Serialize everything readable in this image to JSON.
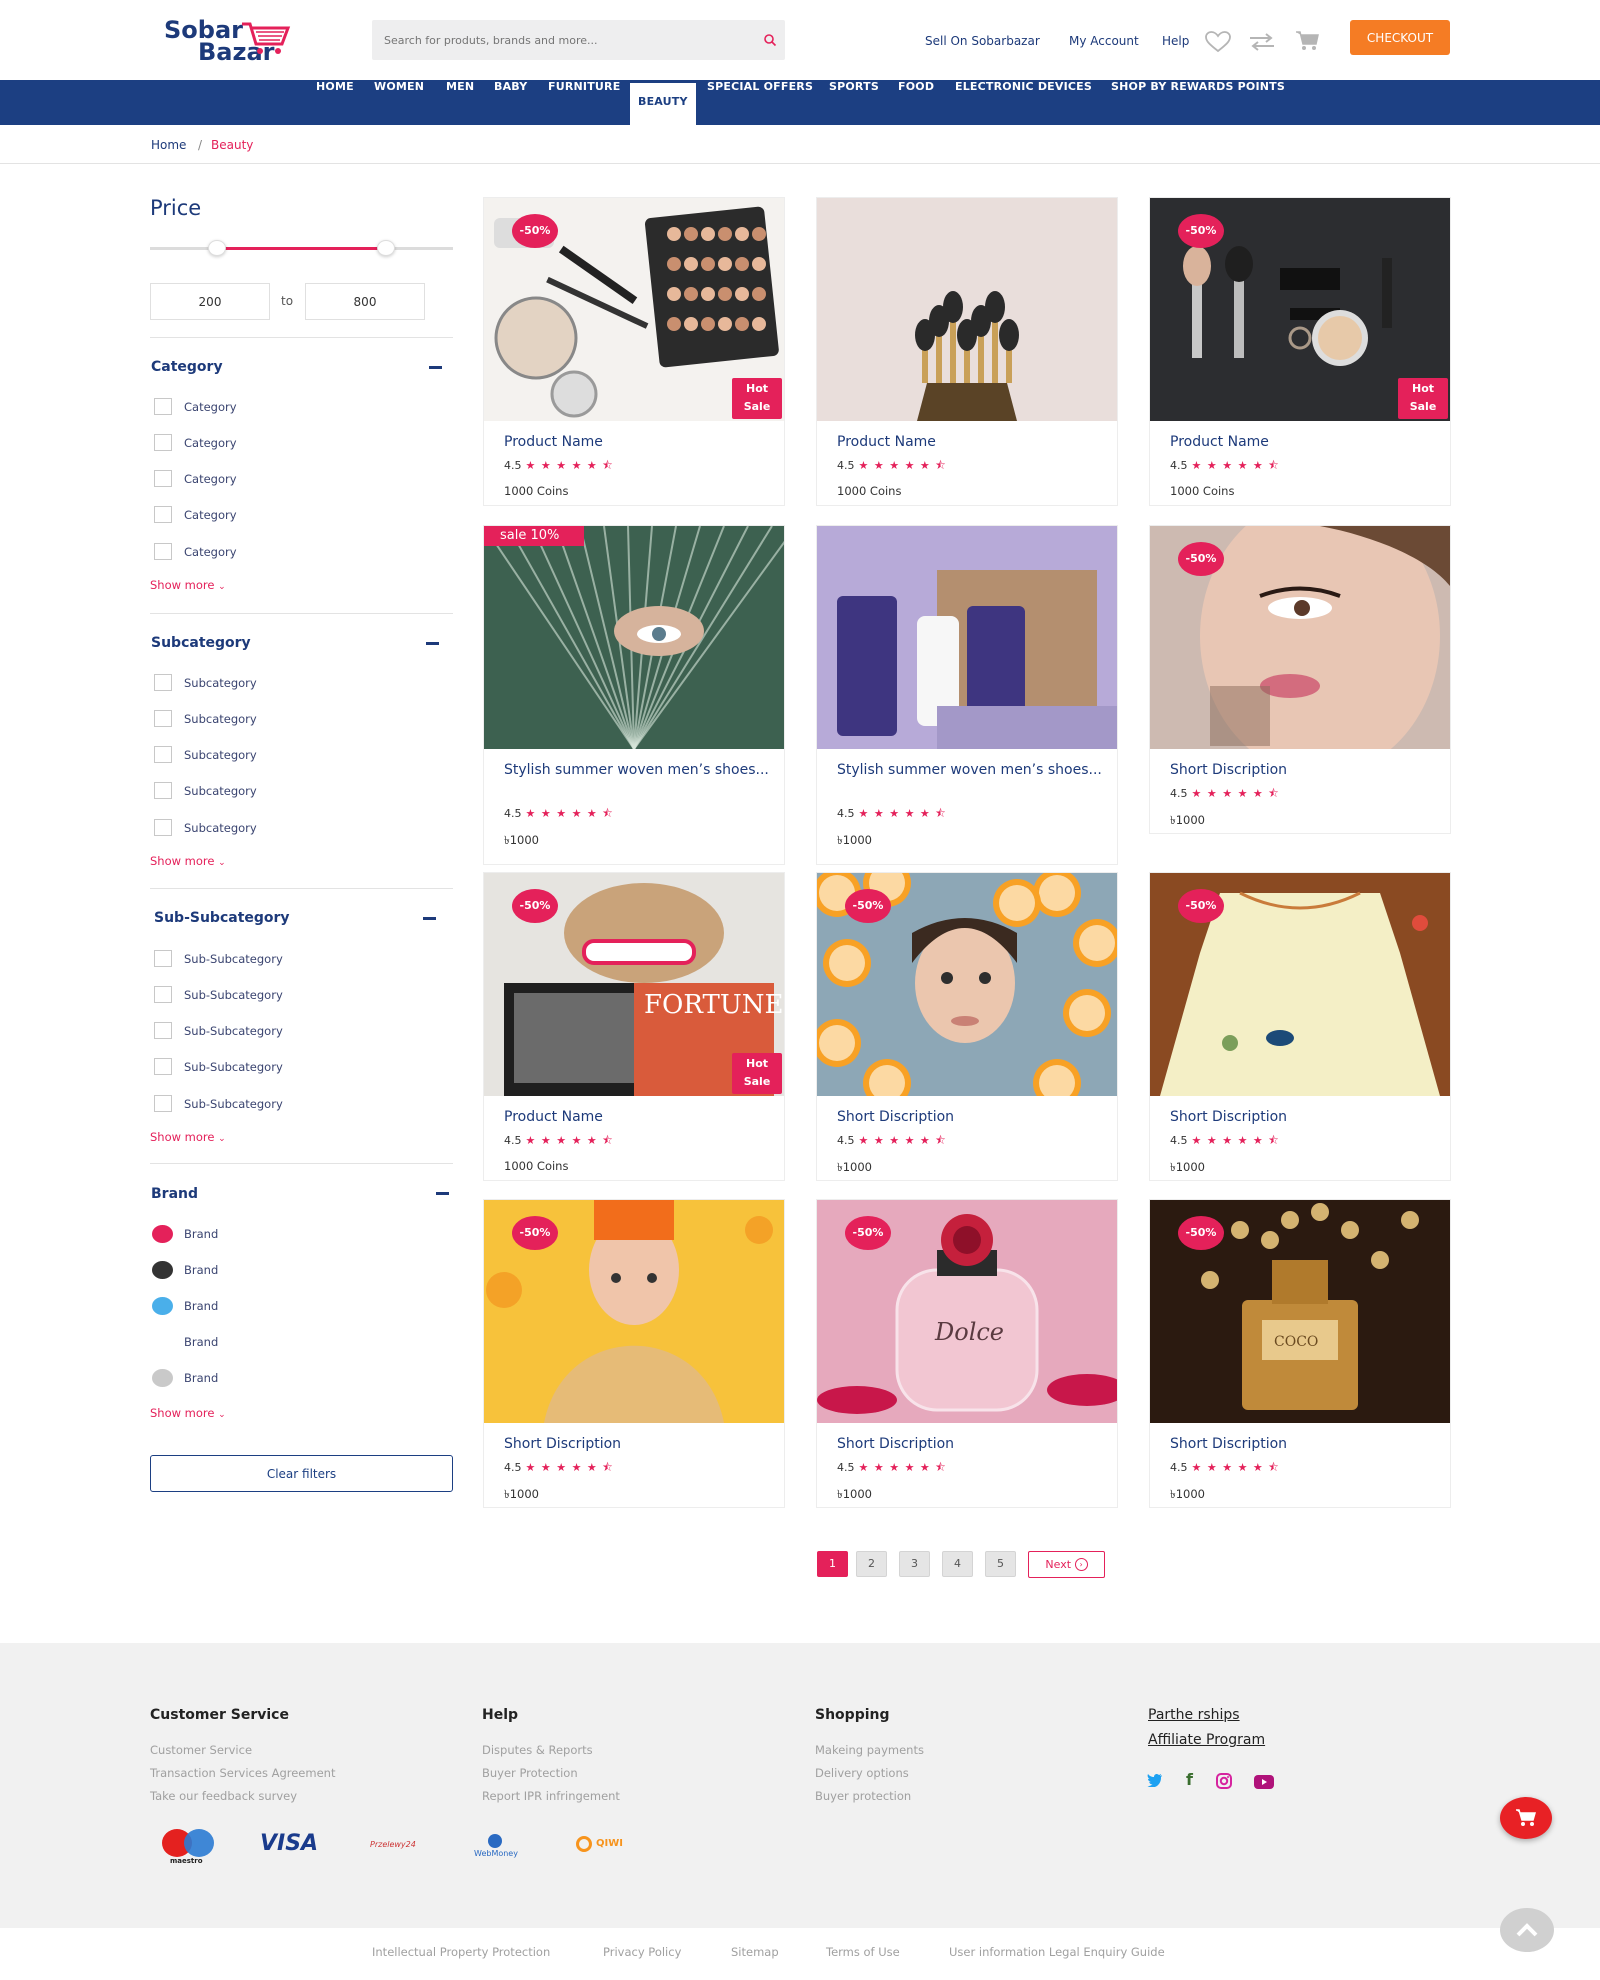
{
  "header": {
    "logo_line1": "Sobar",
    "logo_line2": "Bazar",
    "search_placeholder": "Search for produts, brands and more...",
    "links": [
      "Sell On Sobarbazar",
      "My Account",
      "Help"
    ],
    "checkout_label": "CHECKOUT"
  },
  "nav": {
    "items": [
      "HOME",
      "WOMEN",
      "MEN",
      "BABY",
      "FURNITURE",
      "BEAUTY",
      "SPECIAL OFFERS",
      "SPORTS",
      "FOOD",
      "ELECTRONIC DEVICES",
      "SHOP BY REWARDS POINTS"
    ],
    "active": "BEAUTY"
  },
  "breadcrumb": {
    "home": "Home",
    "separator": "/",
    "current": "Beauty"
  },
  "filters": {
    "price": {
      "title": "Price",
      "min": "200",
      "max": "800",
      "to_label": "to",
      "range_min": 0.22,
      "range_max": 0.78
    },
    "category": {
      "title": "Category",
      "items": [
        "Category",
        "Category",
        "Category",
        "Category",
        "Category"
      ]
    },
    "subcategory": {
      "title": "Subcategory",
      "items": [
        "Subcategory",
        "Subcategory",
        "Subcategory",
        "Subcategory",
        "Subcategory"
      ]
    },
    "subsubcategory": {
      "title": "Sub-Subcategory",
      "items": [
        "Sub-Subcategory",
        "Sub-Subcategory",
        "Sub-Subcategory",
        "Sub-Subcategory",
        "Sub-Subcategory"
      ]
    },
    "brand": {
      "title": "Brand",
      "items": [
        {
          "label": "Brand",
          "color": "#e4215a"
        },
        {
          "label": "Brand",
          "color": "#333333"
        },
        {
          "label": "Brand",
          "color": "#4aafea"
        },
        {
          "label": "Brand",
          "color": "#ffffff"
        },
        {
          "label": "Brand",
          "color": "#c9c9c9"
        }
      ]
    },
    "show_more": "Show more",
    "clear_filters": "Clear filters"
  },
  "products": [
    {
      "name": "Product Name",
      "rating": "4.5",
      "price": "1000 Coins",
      "badge": "-50%",
      "hot": true,
      "image": "makeup-palette"
    },
    {
      "name": "Product Name",
      "rating": "4.5",
      "price": "1000 Coins",
      "badge": "",
      "hot": false,
      "image": "makeup-brushes"
    },
    {
      "name": "Product Name",
      "rating": "4.5",
      "price": "1000 Coins",
      "badge": "-50%",
      "hot": true,
      "image": "cosmetics-dark"
    },
    {
      "name": "Stylish summer woven men’s shoes...",
      "rating": "4.5",
      "price": "৳1000",
      "sale": "sale 10%",
      "image": "leaf-face"
    },
    {
      "name": "Stylish summer woven men’s shoes...",
      "rating": "4.5",
      "price": "৳1000",
      "badge": "",
      "image": "skincare-tubes"
    },
    {
      "name": "Short Discription",
      "rating": "4.5",
      "price": "৳1000",
      "badge": "-50%",
      "image": "lipstick-woman"
    },
    {
      "name": "Product Name",
      "rating": "4.5",
      "price": "1000 Coins",
      "badge": "-50%",
      "hot": true,
      "image": "magazine-woman"
    },
    {
      "name": "Short Discription",
      "rating": "4.5",
      "price": "৳1000",
      "badge": "-50%",
      "image": "citrus-face"
    },
    {
      "name": "Short Discription",
      "rating": "4.5",
      "price": "৳1000",
      "badge": "-50%",
      "image": "yellow-dress"
    },
    {
      "name": "Short Discription",
      "rating": "4.5",
      "price": "৳1000",
      "badge": "-50%",
      "image": "yellow-hair"
    },
    {
      "name": "Short Discription",
      "rating": "4.5",
      "price": "৳1000",
      "badge": "-50%",
      "image": "pink-perfume"
    },
    {
      "name": "Short Discription",
      "rating": "4.5",
      "price": "৳1000",
      "badge": "-50%",
      "image": "coco-perfume"
    }
  ],
  "hot_label_1": "Hot",
  "hot_label_2": "Sale",
  "stars": "★ ★ ★ ★ ★ ⯪",
  "pagination": {
    "pages": [
      "1",
      "2",
      "3",
      "4",
      "5"
    ],
    "active": "1",
    "next": "Next"
  },
  "footer": {
    "columns": [
      {
        "title": "Customer Service",
        "links": [
          "Customer Service",
          "Transaction Services Agreement",
          "Take our feedback survey"
        ]
      },
      {
        "title": "Help",
        "links": [
          "Disputes & Reports",
          "Buyer Protection",
          "Report IPR infringement"
        ]
      },
      {
        "title": "Shopping",
        "links": [
          "Makeing payments",
          "Delivery options",
          "Buyer protection"
        ]
      }
    ],
    "partnerships": "Parthe rships",
    "affiliate": "Affiliate Program",
    "payments": [
      "maestro",
      "VISA",
      "Przelewy24",
      "WebMoney",
      "QIWI"
    ],
    "bottom_links": [
      "Intellectual Property Protection",
      "Privacy Policy",
      "Sitemap",
      "Terms of Use",
      "User information Legal Enquiry Guide"
    ]
  },
  "colors": {
    "primary": "#1c3f82",
    "accent": "#e4215a",
    "checkout": "#f57c24"
  }
}
